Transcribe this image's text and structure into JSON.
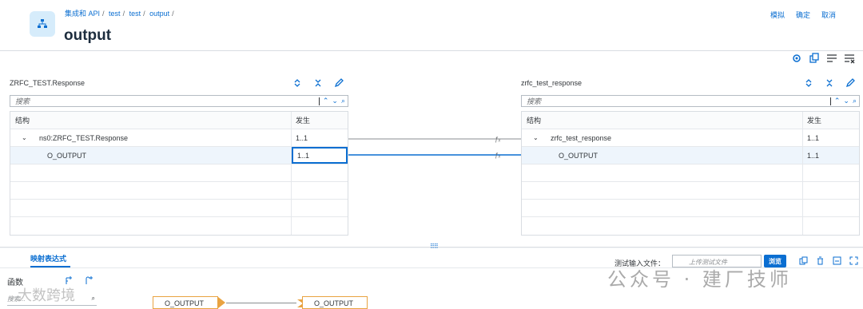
{
  "header": {
    "breadcrumb": [
      "集成和 API",
      "test",
      "test",
      "output"
    ],
    "title": "output",
    "actions": {
      "simulate": "模拟",
      "confirm": "确定",
      "cancel": "取消"
    }
  },
  "source": {
    "name": "ZRFC_TEST.Response",
    "search_placeholder": "搜索",
    "col_structure": "结构",
    "col_occurrence": "发生",
    "rows": [
      {
        "name": "ns0:ZRFC_TEST.Response",
        "occ": "1..1"
      },
      {
        "name": "O_OUTPUT",
        "occ": "1..1"
      }
    ]
  },
  "target": {
    "name": "zrfc_test_response",
    "search_placeholder": "搜索",
    "col_structure": "结构",
    "col_occurrence": "发生",
    "rows": [
      {
        "name": "zrfc_test_response",
        "occ": "1..1"
      },
      {
        "name": "O_OUTPUT",
        "occ": "1..1"
      }
    ]
  },
  "bottom": {
    "tab": "映射表达式",
    "test_input_label": "测试输入文件：",
    "upload_placeholder": "上传测试文件",
    "browse": "浏览",
    "functions_label": "函数",
    "function_search_placeholder": "搜索...",
    "source_node": "O_OUTPUT",
    "target_node": "O_OUTPUT"
  },
  "watermark": "公众号 · 建厂技师",
  "watermark_corner": "大数跨境",
  "colors": {
    "accent": "#0a6ed1",
    "node_border": "#e9a341"
  }
}
